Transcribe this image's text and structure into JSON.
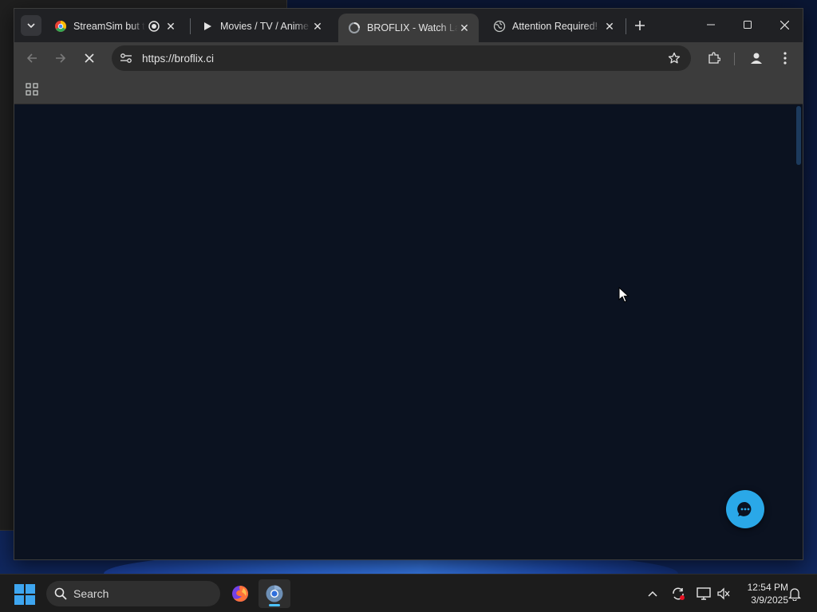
{
  "browser": {
    "tabs": [
      {
        "title": "StreamSim but th",
        "favicon": "chrome-color-icon",
        "extra_icon": "recording-icon",
        "active": false
      },
      {
        "title": "Movies / TV / Anime",
        "favicon": "play-icon",
        "active": false
      },
      {
        "title": "BROFLIX - Watch Lat",
        "favicon": "loading-favicon-icon",
        "active": true
      },
      {
        "title": "Attention Required!",
        "favicon": "globe-icon",
        "active": false
      }
    ],
    "address_bar": {
      "url": "https://broflix.ci"
    },
    "colors": {
      "accent": "#2aa8e8",
      "page_bg": "#0b1220",
      "chrome_bg": "#3c3c3c"
    }
  },
  "taskbar": {
    "search_label": "Search",
    "clock_time": "12:54 PM",
    "clock_date": "3/9/2025",
    "apps": [
      "firefox-icon",
      "chrome-icon"
    ],
    "tray": [
      "chevron-up-icon",
      "sync-icon",
      "network-icon",
      "speaker-muted-icon",
      "notification-bell-icon"
    ]
  }
}
